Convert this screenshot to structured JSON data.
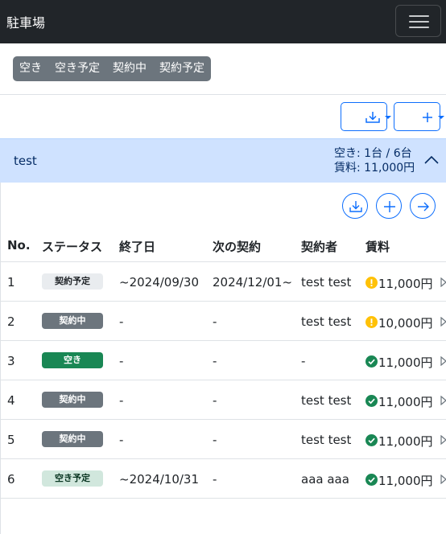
{
  "navbar": {
    "brand": "駐車場",
    "toggle_icon": "hamburger-icon"
  },
  "filters": [
    "空き",
    "空き予定",
    "契約中",
    "契約予定"
  ],
  "toolbar": {
    "download_icon": "download-icon",
    "add_icon": "plus-icon"
  },
  "lot": {
    "name": "test",
    "availability": "空き: 1台 / 6台",
    "fee": "賃料: 11,000円",
    "actions": [
      "download-icon",
      "plus-icon",
      "arrow-right-icon"
    ]
  },
  "table": {
    "headers": [
      "No.",
      "ステータス",
      "終了日",
      "次の契約",
      "契約者",
      "賃料"
    ],
    "rows": [
      {
        "no": "1",
        "status": "契約予定",
        "status_style": "light",
        "end": "~2024/09/30",
        "next": "2024/12/01~",
        "contractor": "test test",
        "pay": "warning",
        "fee": "11,000円"
      },
      {
        "no": "2",
        "status": "契約中",
        "status_style": "secondary",
        "end": "-",
        "next": "-",
        "contractor": "test test",
        "pay": "warning",
        "fee": "10,000円"
      },
      {
        "no": "3",
        "status": "空き",
        "status_style": "success",
        "end": "-",
        "next": "-",
        "contractor": "-",
        "pay": "ok",
        "fee": "11,000円"
      },
      {
        "no": "4",
        "status": "契約中",
        "status_style": "secondary",
        "end": "-",
        "next": "-",
        "contractor": "test test",
        "pay": "ok",
        "fee": "11,000円"
      },
      {
        "no": "5",
        "status": "契約中",
        "status_style": "secondary",
        "end": "-",
        "next": "-",
        "contractor": "test test",
        "pay": "ok",
        "fee": "11,000円"
      },
      {
        "no": "6",
        "status": "空き予定",
        "status_style": "success-subtle",
        "end": "~2024/10/31",
        "next": "-",
        "contractor": "aaa aaa",
        "pay": "ok",
        "fee": "11,000円"
      }
    ]
  },
  "colors": {
    "primary": "#0d6efd",
    "navbar": "#212529",
    "secondary": "#6c757d",
    "success": "#198754",
    "warning": "#ffc107",
    "lot_header": "#cfe2ff"
  }
}
